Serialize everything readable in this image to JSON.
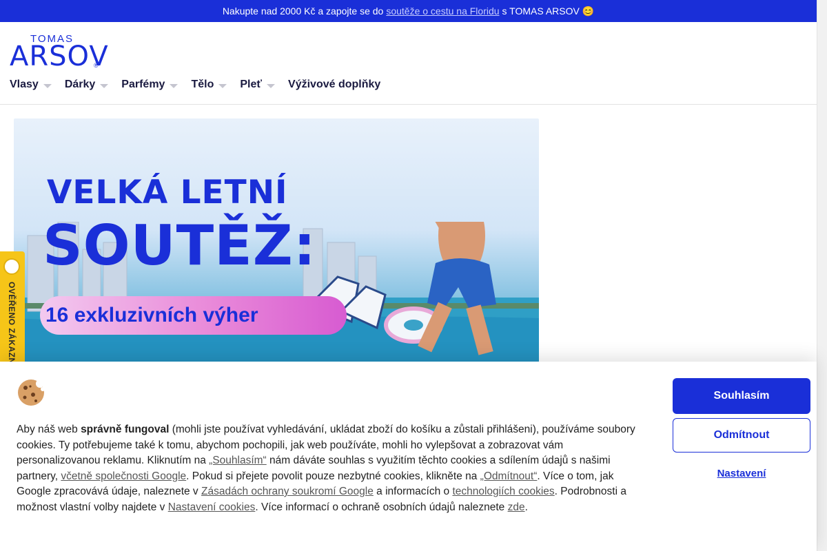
{
  "promo_bar": {
    "text_before": "Nakupte nad 2000 Kč a zapojte se do",
    "link_text": "soutěže o cestu na Floridu",
    "text_after": "s TOMAS ARSOV 😊"
  },
  "logo": {
    "small": "TOMAS",
    "big": "ARSOV",
    "reg": "®"
  },
  "nav": {
    "items": [
      {
        "label": "Vlasy"
      },
      {
        "label": "Dárky"
      },
      {
        "label": "Parfémy"
      },
      {
        "label": "Tělo"
      },
      {
        "label": "Pleť"
      },
      {
        "label": "Výživové doplňky"
      }
    ]
  },
  "banner": {
    "line1": "VELKÁ LETNÍ",
    "line2": "SOUTĚŽ:",
    "pill": "16 exkluzivních výher"
  },
  "verified_badge": {
    "label": "OVĚŘENO ZÁKAZNÍKY"
  },
  "cookie_banner": {
    "p1": "Aby náš web",
    "p1_bold": "správně fungoval",
    "p2": "(mohli jste používat vyhledávání, ukládat zboží do košíku a zůstali přihlášeni), používáme soubory cookies. Ty potřebujeme také k tomu, abychom pochopili, jak web používáte, mohli ho vylepšovat a zobrazovat vám personalizovanou reklamu. Kliknutím na",
    "link_agree": "„Souhlasím“",
    "p3": "nám dáváte souhlas s využitím těchto cookies a sdílením údajů s našimi partnery,",
    "link_google": "včetně společnosti Google",
    "p4": ". Pokud si přejete povolit pouze nezbytné cookies, klikněte na",
    "link_reject": "„Odmítnout“",
    "p5": ". Více o tom, jak Google zpracovává údaje, naleznete v",
    "link_policy": "Zásadách ochrany soukromí Google",
    "p6": "a informacích o",
    "link_tech": "technologiích cookies",
    "p7": ". Podrobnosti a možnost vlastní volby najdete v",
    "link_settings": "Nastavení cookies",
    "p8": ". Více informací o ochraně osobních údajů naleznete",
    "link_here": "zde",
    "p9": ".",
    "btn_agree": "Souhlasím",
    "btn_reject": "Odmítnout",
    "btn_settings": "Nastavení"
  }
}
